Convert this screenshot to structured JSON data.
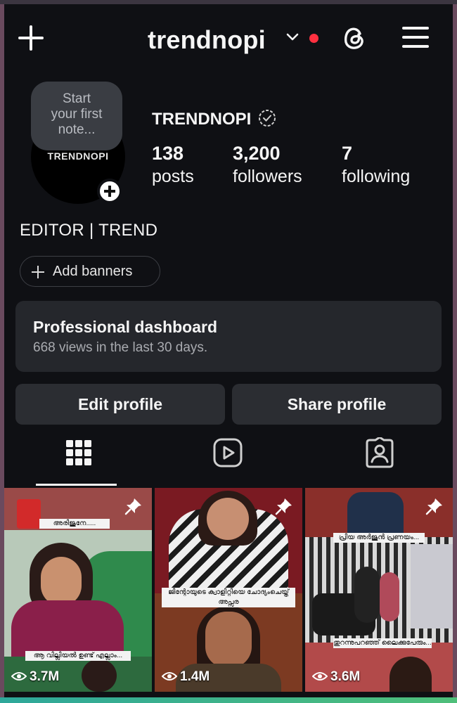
{
  "header": {
    "username": "trendnopi"
  },
  "profile": {
    "note_placeholder": [
      "Start",
      "your first",
      "note..."
    ],
    "avatar_text": "TRENDNOPI",
    "display_name": "TRENDNOPI",
    "stats": [
      {
        "value": "138",
        "label": "posts"
      },
      {
        "value": "3,200",
        "label": "followers"
      },
      {
        "value": "7",
        "label": "following"
      }
    ],
    "bio": "EDITOR | TREND",
    "banners_button": "Add banners"
  },
  "dashboard": {
    "title": "Professional dashboard",
    "subtitle": "668 views in the last 30 days."
  },
  "actions": {
    "edit_profile": "Edit profile",
    "share_profile": "Share profile"
  },
  "tabs": [
    {
      "icon": "grid-icon",
      "active": true
    },
    {
      "icon": "reels-icon",
      "active": false
    },
    {
      "icon": "tagged-icon",
      "active": false
    }
  ],
  "posts": [
    {
      "views": "3.7M",
      "pinned": true,
      "caption_top": "അരിജുനേ.....",
      "caption_bottom": "ആ വില്ലിയൽ ഉണ്ട് എല്ലാം..."
    },
    {
      "views": "1.4M",
      "pinned": true,
      "caption_top": "ജിന്റോയുടെ ക്വാളിറ്റിയെ ചോദ്യംചെയ്ത് അപ്സര",
      "caption_bottom": ""
    },
    {
      "views": "3.6M",
      "pinned": true,
      "caption_top": "പ്രിയ അർജുൻ പ്രണയം...",
      "caption_bottom": "തുറന്നുപറഞ്ഞ് ലൈക്കുപേരും..."
    }
  ],
  "colors": {
    "background": "#0f1014",
    "card": "#25272c",
    "button": "#2b2d32",
    "notification_dot": "#ff3040"
  }
}
